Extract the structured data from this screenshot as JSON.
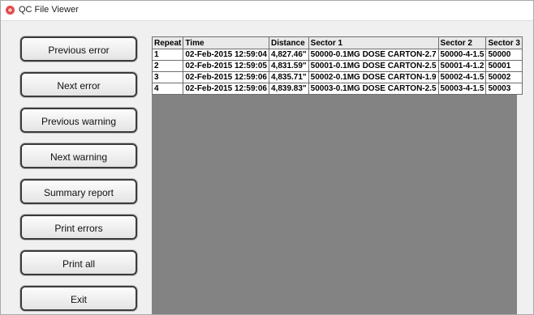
{
  "window": {
    "title": "QC File Viewer"
  },
  "buttons": [
    "Previous error",
    "Next error",
    "Previous warning",
    "Next warning",
    "Summary report",
    "Print errors",
    "Print all",
    "Exit"
  ],
  "table": {
    "headers": [
      "Repeat",
      "Time",
      "Distance",
      "Sector 1",
      "Sector 2",
      "Sector 3"
    ],
    "rows": [
      [
        "1",
        "02-Feb-2015 12:59:04",
        "4,827.46\"",
        "50000-0.1MG DOSE CARTON-2.7",
        "50000-4-1.5",
        "50000"
      ],
      [
        "2",
        "02-Feb-2015 12:59:05",
        "4,831.59\"",
        "50001-0.1MG DOSE CARTON-2.5",
        "50001-4-1.2",
        "50001"
      ],
      [
        "3",
        "02-Feb-2015 12:59:06",
        "4,835.71\"",
        "50002-0.1MG DOSE CARTON-1.9",
        "50002-4-1.5",
        "50002"
      ],
      [
        "4",
        "02-Feb-2015 12:59:06",
        "4,839.83\"",
        "50003-0.1MG DOSE CARTON-2.5",
        "50003-4-1.5",
        "50003"
      ]
    ]
  },
  "colors": {
    "grid_background": "#838383",
    "app_icon": "#d12a2a"
  },
  "icons": {
    "app": "app-logo-icon"
  }
}
